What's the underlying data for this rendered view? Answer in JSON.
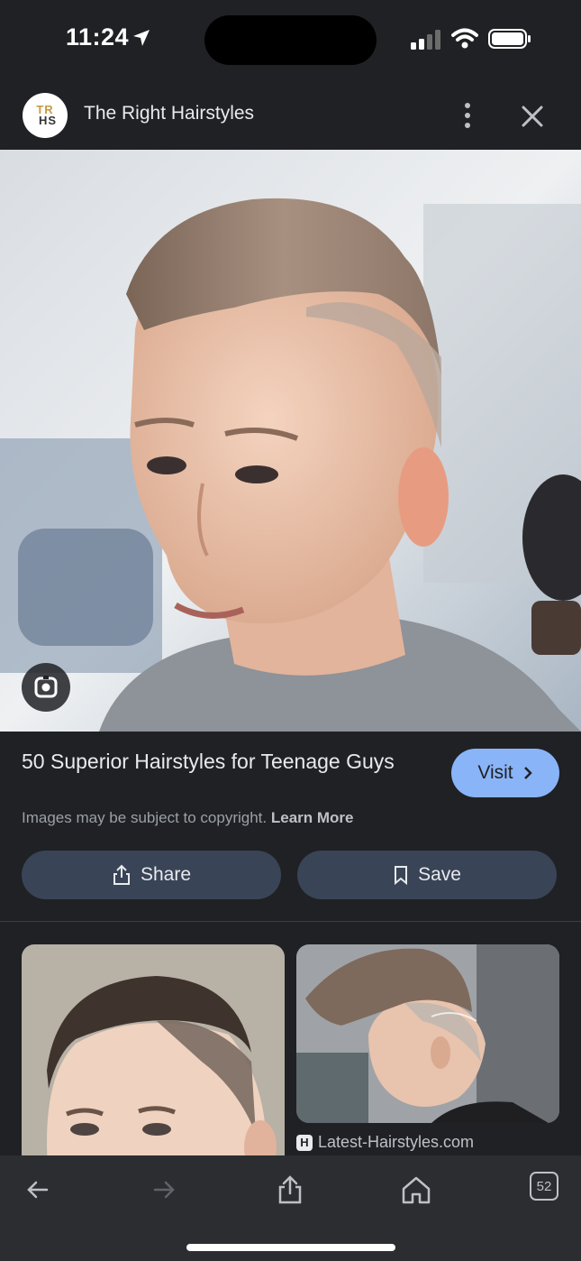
{
  "status_bar": {
    "time": "11:24",
    "icons": [
      "location-arrow-icon",
      "cellular-signal-icon",
      "wifi-icon",
      "battery-icon"
    ]
  },
  "header": {
    "logo_line1": "TR",
    "logo_line2": "HS",
    "site_name": "The Right Hairstyles",
    "icons": [
      "more-vertical-icon",
      "close-icon"
    ]
  },
  "hero": {
    "image": "teen-boy-side-part-haircut-photo",
    "lens_icon": "google-lens-icon"
  },
  "result": {
    "title": "50 Superior Hairstyles for Teenage Guys",
    "copyright_text": "Images may be subject to copyright.",
    "learn_more": "Learn More",
    "visit_label": "Visit",
    "share_label": "Share",
    "save_label": "Save"
  },
  "related": {
    "items": [
      {
        "image": "boy-slick-side-part-photo",
        "source": ""
      },
      {
        "image": "boy-textured-quiff-fade-photo",
        "source": "Latest-Hairstyles.com",
        "source_icon": "H"
      }
    ]
  },
  "toolbar": {
    "icons": [
      "back-arrow-icon",
      "forward-arrow-icon",
      "share-icon",
      "home-icon",
      "tabs-icon"
    ],
    "tab_count": "52"
  },
  "colors": {
    "background": "#202124",
    "accent": "#8ab4f8",
    "button_bg": "#394457",
    "toolbar_bg": "#2c2d30"
  }
}
